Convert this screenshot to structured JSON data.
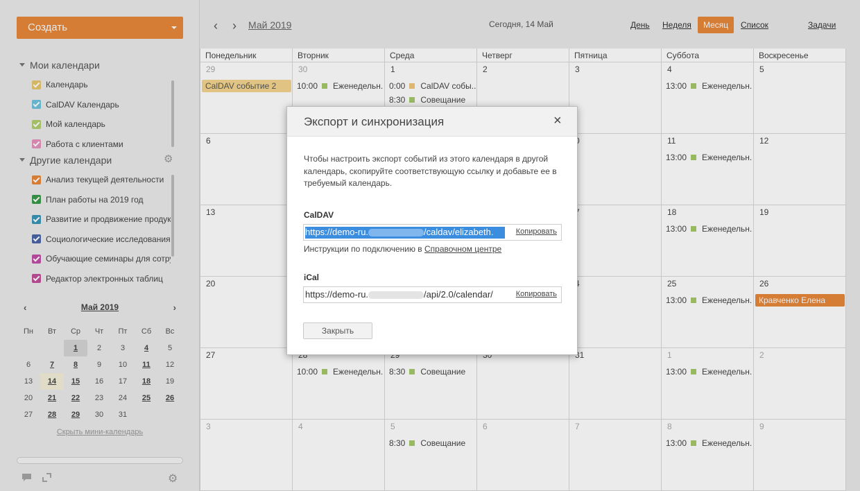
{
  "sidebar": {
    "create_label": "Создать",
    "my_calendars_title": "Мои календари",
    "my_calendars": [
      {
        "name": "Календарь",
        "color": "#e8c66d"
      },
      {
        "name": "CalDAV Календарь",
        "color": "#6ec3de"
      },
      {
        "name": "Мой календарь",
        "color": "#b2cf6e"
      },
      {
        "name": "Работа с клиентами",
        "color": "#e793bd"
      }
    ],
    "other_calendars_title": "Другие календари",
    "other_calendars": [
      {
        "name": "Анализ текущей деятельности",
        "color": "#e8873a"
      },
      {
        "name": "План работы на 2019 год",
        "color": "#3a9a4a"
      },
      {
        "name": "Развитие и продвижение продукта",
        "color": "#3a95b8"
      },
      {
        "name": "Социологические исследования",
        "color": "#4a67a8"
      },
      {
        "name": "Обучающие семинары для сотрудников",
        "color": "#c24fa8"
      },
      {
        "name": "Редактор электронных таблиц",
        "color": "#c24f9a"
      }
    ],
    "mini_calendar": {
      "title": "Май 2019",
      "prev": "‹",
      "next": "›",
      "weekdays": [
        "Пн",
        "Вт",
        "Ср",
        "Чт",
        "Пт",
        "Сб",
        "Вс"
      ],
      "days": [
        {
          "d": "",
          "bold": false
        },
        {
          "d": "",
          "bold": false
        },
        {
          "d": "1",
          "bold": true,
          "sel": true
        },
        {
          "d": "2",
          "bold": false
        },
        {
          "d": "3",
          "bold": false
        },
        {
          "d": "4",
          "bold": true
        },
        {
          "d": "5",
          "bold": false
        },
        {
          "d": "6",
          "bold": false
        },
        {
          "d": "7",
          "bold": true
        },
        {
          "d": "8",
          "bold": true
        },
        {
          "d": "9",
          "bold": false
        },
        {
          "d": "10",
          "bold": false
        },
        {
          "d": "11",
          "bold": true
        },
        {
          "d": "12",
          "bold": false
        },
        {
          "d": "13",
          "bold": false
        },
        {
          "d": "14",
          "bold": true,
          "today": true
        },
        {
          "d": "15",
          "bold": true
        },
        {
          "d": "16",
          "bold": false
        },
        {
          "d": "17",
          "bold": false
        },
        {
          "d": "18",
          "bold": true
        },
        {
          "d": "19",
          "bold": false
        },
        {
          "d": "20",
          "bold": false
        },
        {
          "d": "21",
          "bold": true
        },
        {
          "d": "22",
          "bold": true
        },
        {
          "d": "23",
          "bold": false
        },
        {
          "d": "24",
          "bold": false
        },
        {
          "d": "25",
          "bold": true
        },
        {
          "d": "26",
          "bold": true
        },
        {
          "d": "27",
          "bold": false
        },
        {
          "d": "28",
          "bold": true
        },
        {
          "d": "29",
          "bold": true
        },
        {
          "d": "30",
          "bold": false
        },
        {
          "d": "31",
          "bold": false
        },
        {
          "d": "",
          "bold": false
        },
        {
          "d": "",
          "bold": false
        }
      ],
      "hide_label": "Скрыть мини-календарь"
    }
  },
  "toolbar": {
    "month_label": "Май 2019",
    "today_label": "Сегодня, 14 Май",
    "views": [
      "День",
      "Неделя",
      "Месяц",
      "Список"
    ],
    "active_view": "Месяц",
    "tasks_label": "Задачи"
  },
  "calendar": {
    "weekdays": [
      "Понедельник",
      "Вторник",
      "Среда",
      "Четверг",
      "Пятница",
      "Суббота",
      "Воскресенье"
    ],
    "weeks": [
      [
        {
          "n": "29",
          "dim": true
        },
        {
          "n": "30",
          "dim": true
        },
        {
          "n": "1"
        },
        {
          "n": "2"
        },
        {
          "n": "3"
        },
        {
          "n": "4"
        },
        {
          "n": "5"
        }
      ],
      [
        {
          "n": "6"
        },
        {
          "n": ""
        },
        {
          "n": ""
        },
        {
          "n": ""
        },
        {
          "n": "0"
        },
        {
          "n": "11"
        },
        {
          "n": "12"
        }
      ],
      [
        {
          "n": "13"
        },
        {
          "n": ""
        },
        {
          "n": ""
        },
        {
          "n": ""
        },
        {
          "n": "7"
        },
        {
          "n": "18"
        },
        {
          "n": "19"
        }
      ],
      [
        {
          "n": "20"
        },
        {
          "n": ""
        },
        {
          "n": ""
        },
        {
          "n": ""
        },
        {
          "n": "4"
        },
        {
          "n": "25"
        },
        {
          "n": "26"
        }
      ],
      [
        {
          "n": "27"
        },
        {
          "n": "28"
        },
        {
          "n": "29"
        },
        {
          "n": "30"
        },
        {
          "n": "31"
        },
        {
          "n": "1",
          "dim": true
        },
        {
          "n": "2",
          "dim": true
        }
      ],
      [
        {
          "n": "3",
          "dim": true
        },
        {
          "n": "4",
          "dim": true
        },
        {
          "n": "5",
          "dim": true
        },
        {
          "n": "6",
          "dim": true
        },
        {
          "n": "7",
          "dim": true
        },
        {
          "n": "8",
          "dim": true
        },
        {
          "n": "9",
          "dim": true
        }
      ]
    ],
    "events": [
      {
        "week": 0,
        "day": 1,
        "slot": 0,
        "time": "10:00",
        "title": "Еженедельн...",
        "color": "#a6c96a"
      },
      {
        "week": 0,
        "day": 2,
        "slot": 0,
        "time": "0:00",
        "title": "CalDAV собы...",
        "color": "#f0c67a"
      },
      {
        "week": 0,
        "day": 2,
        "slot": 1,
        "time": "8:30",
        "title": "Совещание",
        "color": "#a6c96a"
      },
      {
        "week": 0,
        "day": 5,
        "slot": 0,
        "time": "13:00",
        "title": "Еженедельн...",
        "color": "#a6c96a"
      },
      {
        "week": 1,
        "day": 5,
        "slot": 0,
        "time": "13:00",
        "title": "Еженедельн...",
        "color": "#a6c96a"
      },
      {
        "week": 2,
        "day": 5,
        "slot": 0,
        "time": "13:00",
        "title": "Еженедельн...",
        "color": "#a6c96a"
      },
      {
        "week": 3,
        "day": 5,
        "slot": 0,
        "time": "13:00",
        "title": "Еженедельн...",
        "color": "#a6c96a"
      },
      {
        "week": 4,
        "day": 1,
        "slot": 0,
        "time": "10:00",
        "title": "Еженедельн...",
        "color": "#a6c96a"
      },
      {
        "week": 4,
        "day": 2,
        "slot": 0,
        "time": "8:30",
        "title": "Совещание",
        "color": "#a6c96a"
      },
      {
        "week": 4,
        "day": 5,
        "slot": 0,
        "time": "13:00",
        "title": "Еженедельн...",
        "color": "#a6c96a"
      },
      {
        "week": 5,
        "day": 2,
        "slot": 0,
        "time": "8:30",
        "title": "Совещание",
        "color": "#a6c96a"
      },
      {
        "week": 5,
        "day": 5,
        "slot": 0,
        "time": "13:00",
        "title": "Еженедельн...",
        "color": "#a6c96a"
      }
    ],
    "bands": [
      {
        "week": 0,
        "day": 0,
        "title": "CalDAV событие 2",
        "bg": "#f5d58f",
        "fg": "#555"
      },
      {
        "week": 3,
        "day": 6,
        "title": "Кравченко Елена",
        "bg": "#e8873a",
        "fg": "#fff"
      }
    ]
  },
  "modal": {
    "title": "Экспорт и синхронизация",
    "close_icon": "×",
    "description": "Чтобы настроить экспорт событий из этого календаря в другой календарь, скопируйте соответствующую ссылку и добавьте ее в требуемый календарь.",
    "caldav_label": "CalDAV",
    "caldav_url_start": "https://demo-ru.",
    "caldav_url_end": "/caldav/elizabeth.",
    "copy_label": "Копировать",
    "instructions_text": "Инструкции по подключению в ",
    "instructions_link": "Справочном центре",
    "ical_label": "iCal",
    "ical_url_start": "https://demo-ru.",
    "ical_url_end": "/api/2.0/calendar/",
    "close_button": "Закрыть"
  }
}
